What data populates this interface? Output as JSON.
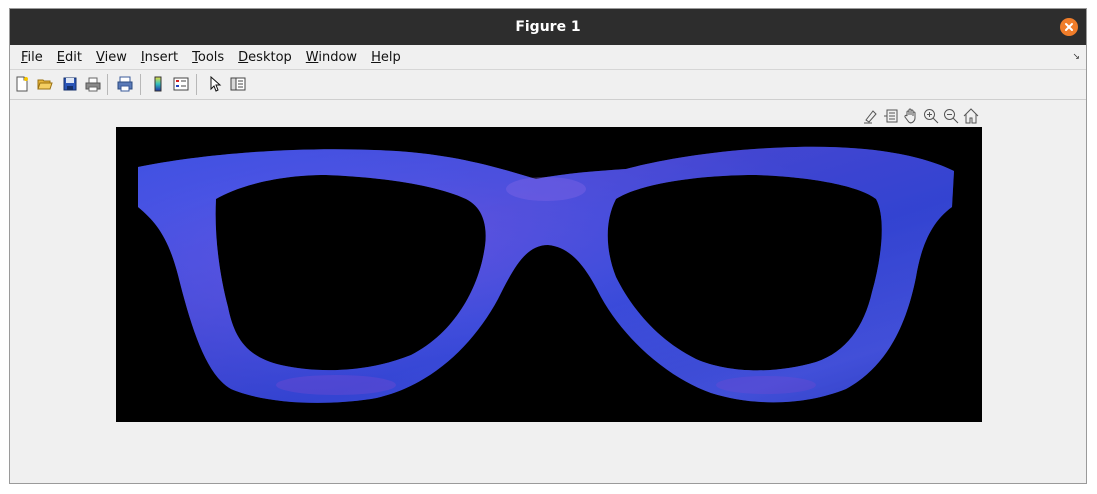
{
  "window": {
    "title": "Figure 1"
  },
  "menu": {
    "items": [
      "File",
      "Edit",
      "View",
      "Insert",
      "Tools",
      "Desktop",
      "Window",
      "Help"
    ]
  },
  "toolbar": {
    "buttons": [
      "new-figure-icon",
      "open-file-icon",
      "save-icon",
      "print-icon",
      "print-preview-icon",
      "colorbar-icon",
      "legend-icon",
      "pointer-icon",
      "property-inspector-icon"
    ]
  },
  "axes_toolbar": {
    "buttons": [
      "brush-icon",
      "data-tips-icon",
      "pan-icon",
      "zoom-in-icon",
      "zoom-out-icon",
      "home-icon"
    ]
  },
  "colors": {
    "titlebar": "#2d2d2d",
    "close": "#f07d2a",
    "frame": "#4a56e0",
    "background": "#000000"
  }
}
